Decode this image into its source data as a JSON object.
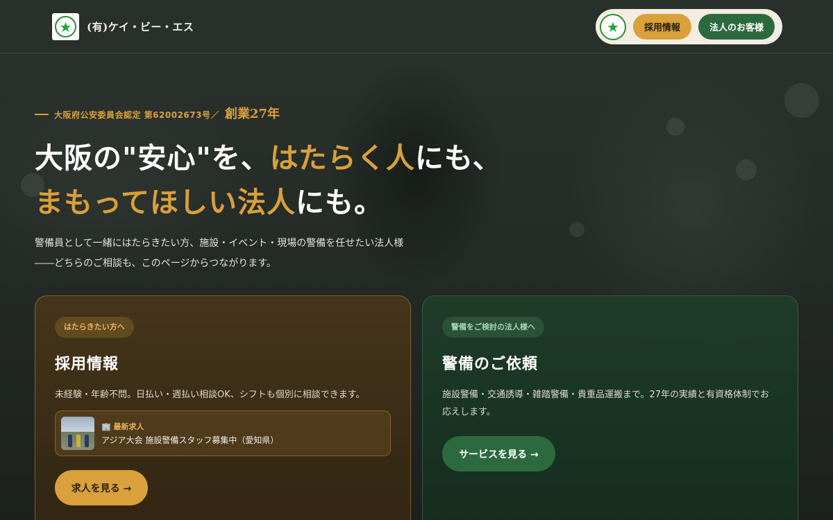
{
  "header": {
    "brand_name": "(有)ケイ・ビー・エス",
    "nav": {
      "recruit_label": "採用情報",
      "corporate_label": "法人のお客様"
    }
  },
  "hero": {
    "certification": "大阪府公安委員会認定 第62002673号／",
    "years": "創業27年",
    "headline": {
      "l1_a": "大阪の\"安心\"を、",
      "l1_b": "はたらく人",
      "l1_c": "にも、",
      "l2_a": "まもってほしい法人",
      "l2_b": "にも。"
    },
    "lead_1": "警備員として一緒にはたらきたい方、施設・イベント・現場の警備を任せたい法人様",
    "lead_2": "――どちらのご相談も、このページからつながります。"
  },
  "cards": {
    "recruit": {
      "tag": "はたらきたい方へ",
      "title": "採用情報",
      "description": "未経験・年齢不問。日払い・週払い相談OK、シフトも個別に相談できます。",
      "latest_job_label": "🏢 最新求人",
      "latest_job_title": "アジア大会 施設警備スタッフ募集中（愛知県）",
      "button": "求人を見る →"
    },
    "service": {
      "tag": "警備をご検討の法人様へ",
      "title": "警備のご依頼",
      "description": "施設警備・交通誘導・雑踏警備・貴重品運搬まで。27年の実績と有資格体制でお応えします。",
      "button": "サービスを見る →"
    }
  },
  "colors": {
    "gold": "#d9a03b",
    "green": "#2c6a3e",
    "logo_star": "#1aa53a"
  },
  "icons": {
    "logo": "star-emblem-icon",
    "job": "building-icon"
  }
}
